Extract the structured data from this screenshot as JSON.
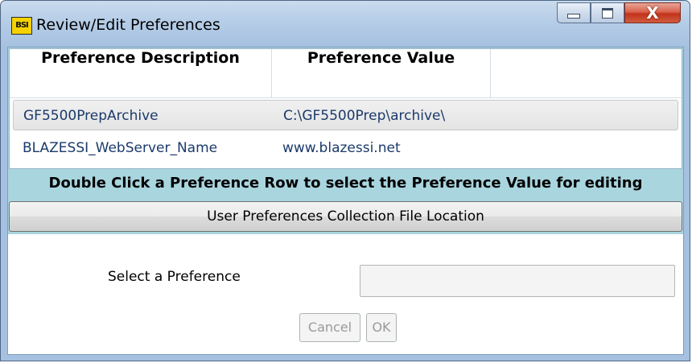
{
  "window": {
    "title": "Review/Edit Preferences",
    "app_icon_text": "BSI",
    "close_glyph": "X"
  },
  "grid": {
    "columns": [
      "Preference Description",
      "Preference Value"
    ],
    "rows": [
      {
        "description": "GF5500PrepArchive",
        "value": "C:\\GF5500Prep\\archive\\",
        "selected": true
      },
      {
        "description": "BLAZESSI_WebServer_Name",
        "value": "www.blazessi.net",
        "selected": false
      }
    ]
  },
  "instruction_text": "Double Click a Preference Row to select the Preference Value for editing",
  "file_location_button": "User Preferences Collection File Location",
  "select_preference": {
    "label": "Select a Preference",
    "value": "",
    "enabled": false
  },
  "buttons": {
    "cancel": "Cancel",
    "ok": "OK"
  },
  "colors": {
    "panel_background": "#a9d5df",
    "row_text": "#1b3a6b",
    "close_button": "#c2331b"
  }
}
